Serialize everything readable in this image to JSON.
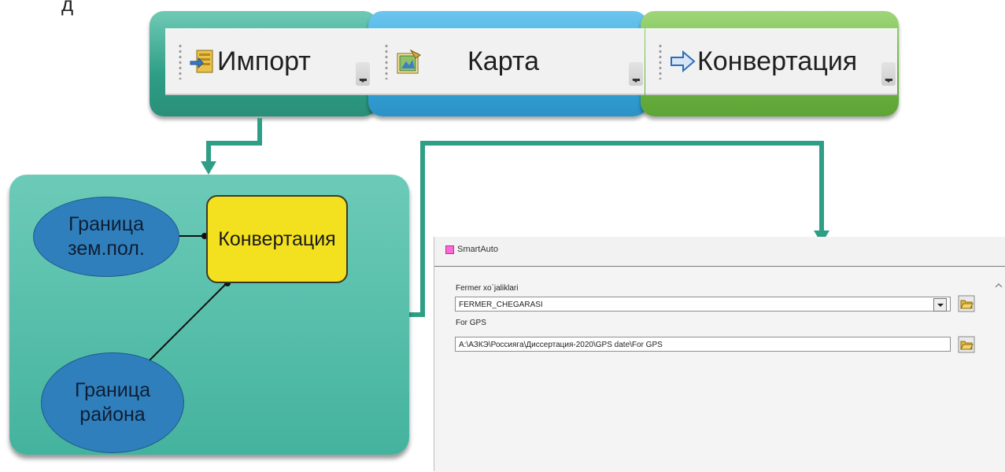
{
  "corner_mark": "д",
  "toolbars": [
    {
      "label": "Импорт",
      "icon": "import-icon",
      "group_color": "#3aa98f"
    },
    {
      "label": "Карта",
      "icon": "map-document-icon",
      "group_color": "#3aa8df"
    },
    {
      "label": "Конвертация",
      "icon": "arrow-right-icon",
      "group_color": "#6cb845"
    }
  ],
  "model": {
    "input1": "Граница\nзем.пол.",
    "input2": "Граница\nрайона",
    "process": "Конвертация",
    "panel_color": "#55bca7",
    "ellipse_color": "#2f7fbd",
    "process_color": "#f3e11f"
  },
  "dialog": {
    "title": "SmartAuto",
    "field1_label": "Fermer xo`jaliklari",
    "field1_value": "FERMER_CHEGARASI",
    "field2_label": "For GPS",
    "field2_value": "A:\\АЗКЭ\\Россиягa\\Диссертация-2020\\GPS date\\For GPS"
  },
  "connector_color": "#2f9e86"
}
